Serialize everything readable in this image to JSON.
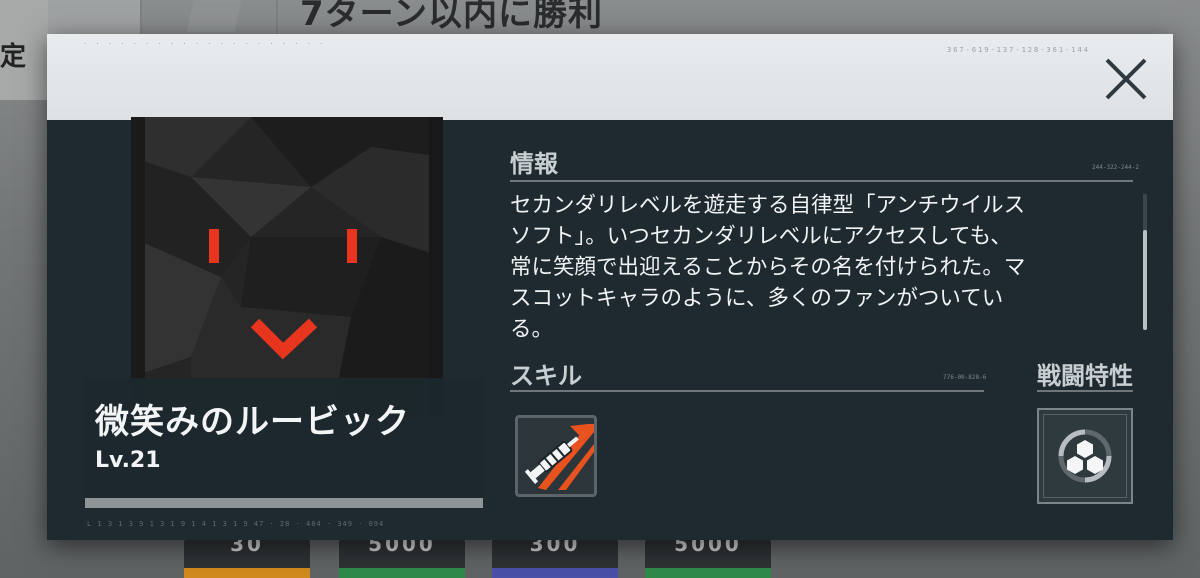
{
  "background": {
    "left_tab_label": "定",
    "title": "7ターン以内に勝利",
    "footer_items": [
      {
        "value": "30",
        "color": "#d08a1d"
      },
      {
        "value": "5000",
        "color": "#2f8a4a"
      },
      {
        "value": "300",
        "color": "#4a4fa8"
      },
      {
        "value": "5000",
        "color": "#2f8a4a"
      }
    ]
  },
  "modal": {
    "close_label": "×",
    "header_code_left": "· · · · ·  · · · · ·  · · · · ·  · · · · ·",
    "header_code_right": "367-619-137-128-361-144",
    "character": {
      "name": "微笑みのルービック",
      "level": "Lv.21",
      "id_strip": "L 1 3 1 3 9 1 3 1 9 1 4 1 3 1 9  47 · 28 · 484 · 349 · 094"
    },
    "info": {
      "title": "情報",
      "code": "244-322-244-2",
      "lines": [
        "セカンダリレベルを遊走する自律型「アンチウイルス",
        "ソフト」。いつセカンダリレベルにアクセスしても、",
        "常に笑顔で出迎えることからその名を付けられた。マ",
        "スコットキャラのように、多くのファンがついてい",
        "る。"
      ]
    },
    "skill": {
      "title": "スキル",
      "code": "776-00-828-6",
      "icon": "syringe-icon"
    },
    "trait": {
      "title": "戦闘特性",
      "icon": "hexagon-cluster-icon"
    },
    "colors": {
      "accent_red": "#e8361e",
      "panel": "#1e2a30",
      "header": "#e3e6e9"
    }
  }
}
